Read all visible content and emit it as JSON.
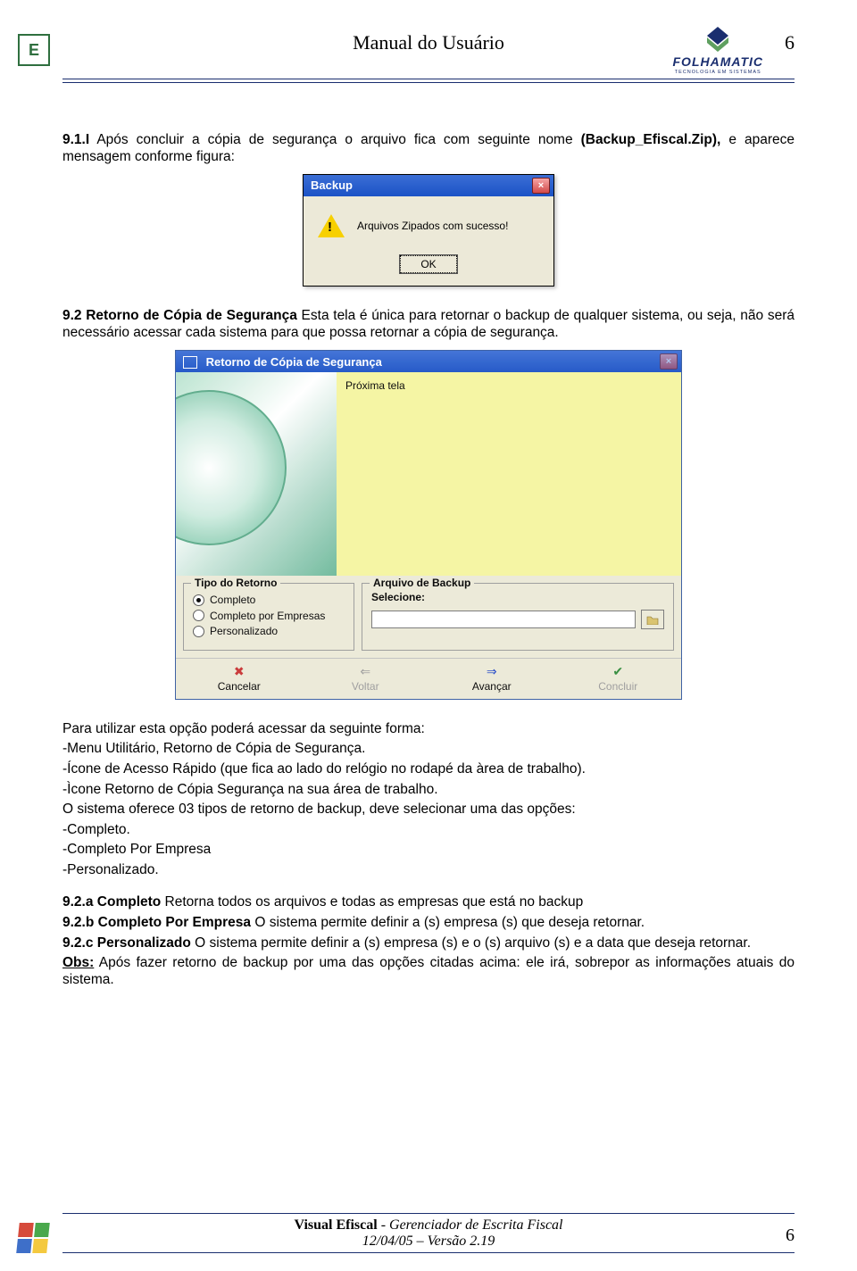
{
  "header": {
    "title": "Manual do Usuário",
    "page_top": "6",
    "logo_left_letter": "E",
    "brand_name": "FOLHAMATIC",
    "brand_sub": "TECNOLOGIA EM SISTEMAS"
  },
  "body": {
    "p1_prefix": "9.1.I",
    "p1_text": " Após concluir a cópia de segurança o arquivo fica com seguinte nome ",
    "p1_bold": "(Backup_Efiscal.Zip),",
    "p1_suffix": " e aparece mensagem conforme figura:",
    "p2_prefix": "9.2 Retorno de Cópia de Segurança",
    "p2_text": " Esta tela é única para retornar o backup de qualquer sistema, ou seja, não será necessário acessar cada sistema para que possa retornar a cópia de segurança.",
    "para_after_wizard_1": "Para utilizar esta opção poderá acessar da seguinte forma:",
    "para_after_wizard_2": "-Menu Utilitário, Retorno de Cópia de Segurança.",
    "para_after_wizard_3": "-Ícone de Acesso Rápido (que fica ao lado do relógio no rodapé da àrea de trabalho).",
    "para_after_wizard_4": "-Ìcone Retorno de Cópia Segurança na sua área de trabalho.",
    "para_after_wizard_5": "O sistema oferece 03 tipos de retorno de backup, deve selecionar uma das opções:",
    "para_after_wizard_6": "-Completo.",
    "para_after_wizard_7": "-Completo Por Empresa",
    "para_after_wizard_8": "-Personalizado.",
    "p92a_prefix": "9.2.a Completo",
    "p92a_text": " Retorna todos os arquivos e todas as empresas que está no backup",
    "p92b_prefix": "9.2.b Completo Por Empresa",
    "p92b_text": " O sistema permite definir a (s) empresa (s) que deseja retornar.",
    "p92c_prefix": "9.2.c Personalizado",
    "p92c_text": " O sistema permite definir a (s) empresa (s) e o (s) arquivo (s) e a data que deseja retornar.",
    "obs_label": "Obs:",
    "obs_text": " Após fazer retorno de backup por uma das opções citadas acima: ele irá, sobrepor as informações atuais do sistema."
  },
  "backup_dialog": {
    "title": "Backup",
    "message": "Arquivos Zipados com sucesso!",
    "ok": "OK"
  },
  "wizard": {
    "title": "Retorno de Cópia de Segurança",
    "hint": "Próxima tela",
    "group_tipo": "Tipo do Retorno",
    "radios": [
      "Completo",
      "Completo por Empresas",
      "Personalizado"
    ],
    "group_arquivo": "Arquivo de Backup",
    "label_selecione": "Selecione:",
    "buttons": {
      "cancel": "Cancelar",
      "back": "Voltar",
      "next": "Avançar",
      "finish": "Concluir"
    }
  },
  "footer": {
    "line1_bold": "Visual Efiscal",
    "line1_rest": " - Gerenciador de Escrita Fiscal",
    "line2": "12/04/05 – Versão 2.19",
    "page_bottom": "6"
  }
}
